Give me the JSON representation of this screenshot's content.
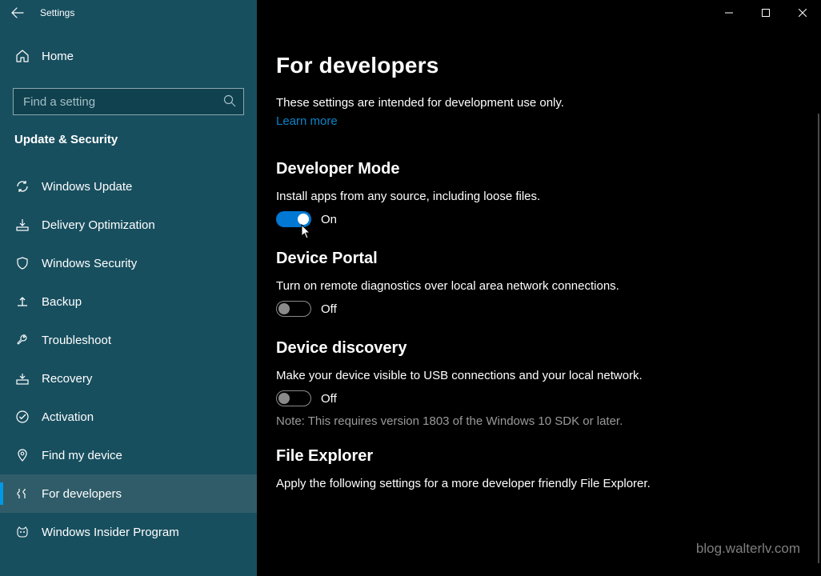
{
  "window_title": "Settings",
  "home_label": "Home",
  "search_placeholder": "Find a setting",
  "category": "Update & Security",
  "nav": [
    {
      "key": "windows-update",
      "label": "Windows Update"
    },
    {
      "key": "delivery-optimization",
      "label": "Delivery Optimization"
    },
    {
      "key": "windows-security",
      "label": "Windows Security"
    },
    {
      "key": "backup",
      "label": "Backup"
    },
    {
      "key": "troubleshoot",
      "label": "Troubleshoot"
    },
    {
      "key": "recovery",
      "label": "Recovery"
    },
    {
      "key": "activation",
      "label": "Activation"
    },
    {
      "key": "find-my-device",
      "label": "Find my device"
    },
    {
      "key": "for-developers",
      "label": "For developers"
    },
    {
      "key": "windows-insider",
      "label": "Windows Insider Program"
    }
  ],
  "page": {
    "title": "For developers",
    "intro": "These settings are intended for development use only.",
    "learn_more": "Learn more",
    "sections": {
      "dev_mode": {
        "title": "Developer Mode",
        "desc": "Install apps from any source, including loose files.",
        "state": "On"
      },
      "device_portal": {
        "title": "Device Portal",
        "desc": "Turn on remote diagnostics over local area network connections.",
        "state": "Off"
      },
      "device_discovery": {
        "title": "Device discovery",
        "desc": "Make your device visible to USB connections and your local network.",
        "state": "Off",
        "note": "Note: This requires version 1803 of the Windows 10 SDK or later."
      },
      "file_explorer": {
        "title": "File Explorer",
        "desc": "Apply the following settings for a more developer friendly File Explorer."
      }
    }
  },
  "watermark": "blog.walterlv.com"
}
